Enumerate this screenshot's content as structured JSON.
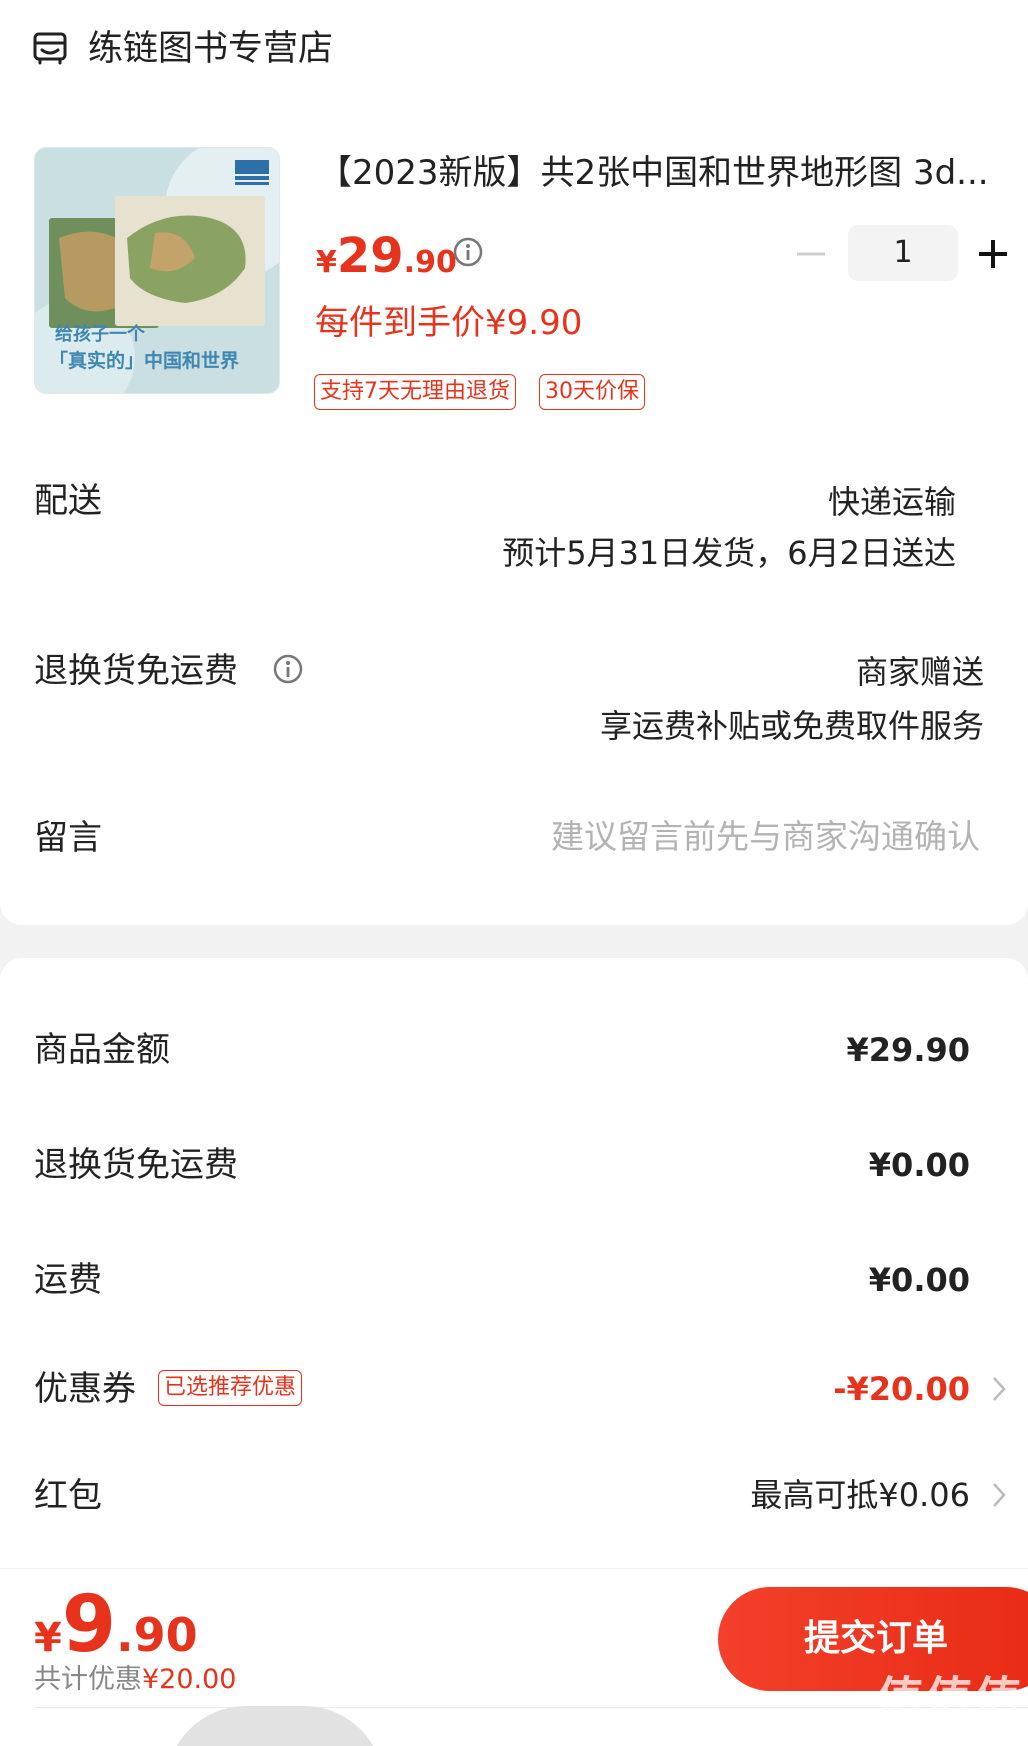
{
  "store": {
    "name": "练链图书专营店",
    "icon": "store-icon"
  },
  "product": {
    "title": "【2023新版】共2张中国和世界地形图 3d...",
    "thumb_text": {
      "line1": "给孩子一个",
      "line2": "「真实的」中国和世界"
    },
    "price_currency": "¥",
    "price_int": "29",
    "price_dec": ".90",
    "hand_price_label": "每件到手价¥9.90",
    "quantity": "1",
    "tags": [
      "支持7天无理由退货",
      "30天价保"
    ]
  },
  "delivery": {
    "label": "配送",
    "method": "快递运输",
    "estimate": "预计5月31日发货，6月2日送达"
  },
  "return_shipping": {
    "label": "退换货免运费",
    "value": "商家赠送",
    "desc": "享运费补贴或免费取件服务"
  },
  "message": {
    "label": "留言",
    "placeholder": "建议留言前先与商家沟通确认"
  },
  "summary": {
    "goods_amount": {
      "label": "商品金额",
      "value": "¥29.90"
    },
    "return_fee": {
      "label": "退换货免运费",
      "value": "¥0.00"
    },
    "shipping": {
      "label": "运费",
      "value": "¥0.00"
    },
    "coupon": {
      "label": "优惠券",
      "badge": "已选推荐优惠",
      "value": "-¥20.00"
    },
    "red_packet": {
      "label": "红包",
      "value": "最高可抵¥0.06"
    }
  },
  "footer": {
    "total_currency": "¥",
    "total_int": "9",
    "total_dec": ".90",
    "saving_label": "共计优惠",
    "saving_value": "¥20.00",
    "submit": "提交订单",
    "watermark": "值值值",
    "watermark_url": "zhizhizhi.com"
  },
  "colors": {
    "accent": "#e8331c",
    "background": "#f2f2f2"
  }
}
